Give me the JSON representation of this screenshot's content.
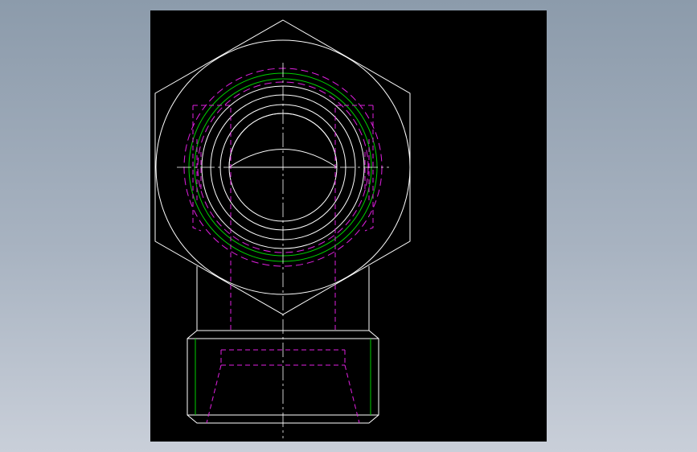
{
  "colors": {
    "background_top": "#8c9bab",
    "background_bottom": "#c9cfd9",
    "viewport": "#000000",
    "visible_edges": "#ffffff",
    "hidden_edges": "#e020e0",
    "thread_circle": "#00d000",
    "center_lines": "#ffffff"
  },
  "drawing": {
    "subject": "hex-fitting-top-and-front-view",
    "views": [
      "top-view-hex-nut",
      "front-view-body"
    ],
    "line_types": [
      "visible",
      "hidden-dashed",
      "center-dashdot",
      "thread"
    ]
  }
}
